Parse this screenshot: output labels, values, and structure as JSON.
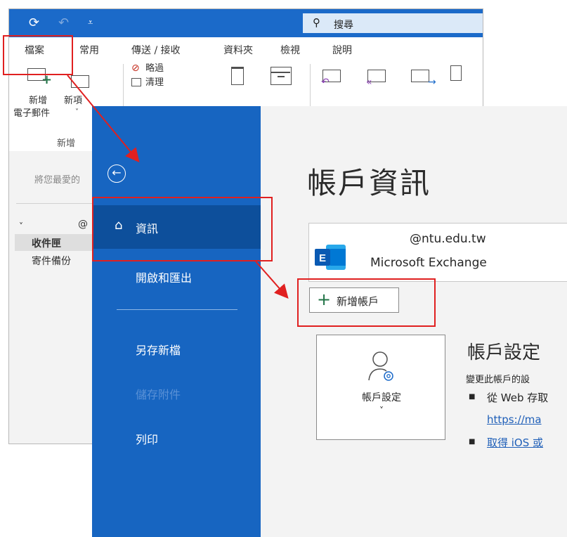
{
  "outlook": {
    "search_label": "搜尋",
    "tabs": [
      "檔案",
      "常用",
      "傳送 / 接收",
      "資料夾",
      "檢視",
      "說明"
    ],
    "ribbon": {
      "new_email": [
        "新增",
        "電子郵件"
      ],
      "new_items": [
        "新項",
        "˅"
      ],
      "ignore": "略過",
      "clean_partial": "清理",
      "group_new": "新增"
    },
    "folderpane": {
      "favorites_hint": "將您最愛的",
      "account_at": "@",
      "inbox": "收件匣",
      "sent_backup": "寄件備份"
    }
  },
  "backstage": {
    "nav": {
      "info": "資訊",
      "open_export": "開啟和匯出",
      "save_as": "另存新檔",
      "save_attachments": "儲存附件",
      "print": "列印"
    },
    "title": "帳戶資訊",
    "account": {
      "email": "@ntu.edu.tw",
      "type": "Microsoft Exchange"
    },
    "add_account": "新增帳戶",
    "settings_tile": {
      "label": "帳戶設定",
      "chevron": "˅"
    },
    "settings_section": {
      "title": "帳戶設定",
      "description": "變更此帳戶的設",
      "bullet1": "從 Web 存取",
      "link1": "https://ma",
      "link2": "取得 iOS 或"
    }
  },
  "colors": {
    "accent": "#1b6ac9",
    "backstage_nav": "#1765c1",
    "nav_selected": "#0d4f9b",
    "annotation": "#e02020"
  }
}
